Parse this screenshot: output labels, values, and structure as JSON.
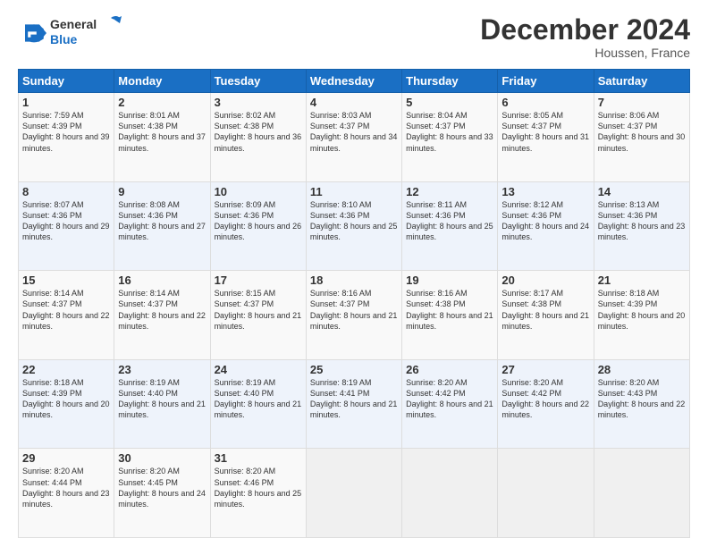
{
  "logo": {
    "line1": "General",
    "line2": "Blue"
  },
  "header": {
    "month": "December 2024",
    "location": "Houssen, France"
  },
  "weekdays": [
    "Sunday",
    "Monday",
    "Tuesday",
    "Wednesday",
    "Thursday",
    "Friday",
    "Saturday"
  ],
  "weeks": [
    [
      {
        "day": 1,
        "sunrise": "7:59 AM",
        "sunset": "4:39 PM",
        "daylight": "8 hours and 39 minutes."
      },
      {
        "day": 2,
        "sunrise": "8:01 AM",
        "sunset": "4:38 PM",
        "daylight": "8 hours and 37 minutes."
      },
      {
        "day": 3,
        "sunrise": "8:02 AM",
        "sunset": "4:38 PM",
        "daylight": "8 hours and 36 minutes."
      },
      {
        "day": 4,
        "sunrise": "8:03 AM",
        "sunset": "4:37 PM",
        "daylight": "8 hours and 34 minutes."
      },
      {
        "day": 5,
        "sunrise": "8:04 AM",
        "sunset": "4:37 PM",
        "daylight": "8 hours and 33 minutes."
      },
      {
        "day": 6,
        "sunrise": "8:05 AM",
        "sunset": "4:37 PM",
        "daylight": "8 hours and 31 minutes."
      },
      {
        "day": 7,
        "sunrise": "8:06 AM",
        "sunset": "4:37 PM",
        "daylight": "8 hours and 30 minutes."
      }
    ],
    [
      {
        "day": 8,
        "sunrise": "8:07 AM",
        "sunset": "4:36 PM",
        "daylight": "8 hours and 29 minutes."
      },
      {
        "day": 9,
        "sunrise": "8:08 AM",
        "sunset": "4:36 PM",
        "daylight": "8 hours and 27 minutes."
      },
      {
        "day": 10,
        "sunrise": "8:09 AM",
        "sunset": "4:36 PM",
        "daylight": "8 hours and 26 minutes."
      },
      {
        "day": 11,
        "sunrise": "8:10 AM",
        "sunset": "4:36 PM",
        "daylight": "8 hours and 25 minutes."
      },
      {
        "day": 12,
        "sunrise": "8:11 AM",
        "sunset": "4:36 PM",
        "daylight": "8 hours and 25 minutes."
      },
      {
        "day": 13,
        "sunrise": "8:12 AM",
        "sunset": "4:36 PM",
        "daylight": "8 hours and 24 minutes."
      },
      {
        "day": 14,
        "sunrise": "8:13 AM",
        "sunset": "4:36 PM",
        "daylight": "8 hours and 23 minutes."
      }
    ],
    [
      {
        "day": 15,
        "sunrise": "8:14 AM",
        "sunset": "4:37 PM",
        "daylight": "8 hours and 22 minutes."
      },
      {
        "day": 16,
        "sunrise": "8:14 AM",
        "sunset": "4:37 PM",
        "daylight": "8 hours and 22 minutes."
      },
      {
        "day": 17,
        "sunrise": "8:15 AM",
        "sunset": "4:37 PM",
        "daylight": "8 hours and 21 minutes."
      },
      {
        "day": 18,
        "sunrise": "8:16 AM",
        "sunset": "4:37 PM",
        "daylight": "8 hours and 21 minutes."
      },
      {
        "day": 19,
        "sunrise": "8:16 AM",
        "sunset": "4:38 PM",
        "daylight": "8 hours and 21 minutes."
      },
      {
        "day": 20,
        "sunrise": "8:17 AM",
        "sunset": "4:38 PM",
        "daylight": "8 hours and 21 minutes."
      },
      {
        "day": 21,
        "sunrise": "8:18 AM",
        "sunset": "4:39 PM",
        "daylight": "8 hours and 20 minutes."
      }
    ],
    [
      {
        "day": 22,
        "sunrise": "8:18 AM",
        "sunset": "4:39 PM",
        "daylight": "8 hours and 20 minutes."
      },
      {
        "day": 23,
        "sunrise": "8:19 AM",
        "sunset": "4:40 PM",
        "daylight": "8 hours and 21 minutes."
      },
      {
        "day": 24,
        "sunrise": "8:19 AM",
        "sunset": "4:40 PM",
        "daylight": "8 hours and 21 minutes."
      },
      {
        "day": 25,
        "sunrise": "8:19 AM",
        "sunset": "4:41 PM",
        "daylight": "8 hours and 21 minutes."
      },
      {
        "day": 26,
        "sunrise": "8:20 AM",
        "sunset": "4:42 PM",
        "daylight": "8 hours and 21 minutes."
      },
      {
        "day": 27,
        "sunrise": "8:20 AM",
        "sunset": "4:42 PM",
        "daylight": "8 hours and 22 minutes."
      },
      {
        "day": 28,
        "sunrise": "8:20 AM",
        "sunset": "4:43 PM",
        "daylight": "8 hours and 22 minutes."
      }
    ],
    [
      {
        "day": 29,
        "sunrise": "8:20 AM",
        "sunset": "4:44 PM",
        "daylight": "8 hours and 23 minutes."
      },
      {
        "day": 30,
        "sunrise": "8:20 AM",
        "sunset": "4:45 PM",
        "daylight": "8 hours and 24 minutes."
      },
      {
        "day": 31,
        "sunrise": "8:20 AM",
        "sunset": "4:46 PM",
        "daylight": "8 hours and 25 minutes."
      },
      null,
      null,
      null,
      null
    ]
  ]
}
